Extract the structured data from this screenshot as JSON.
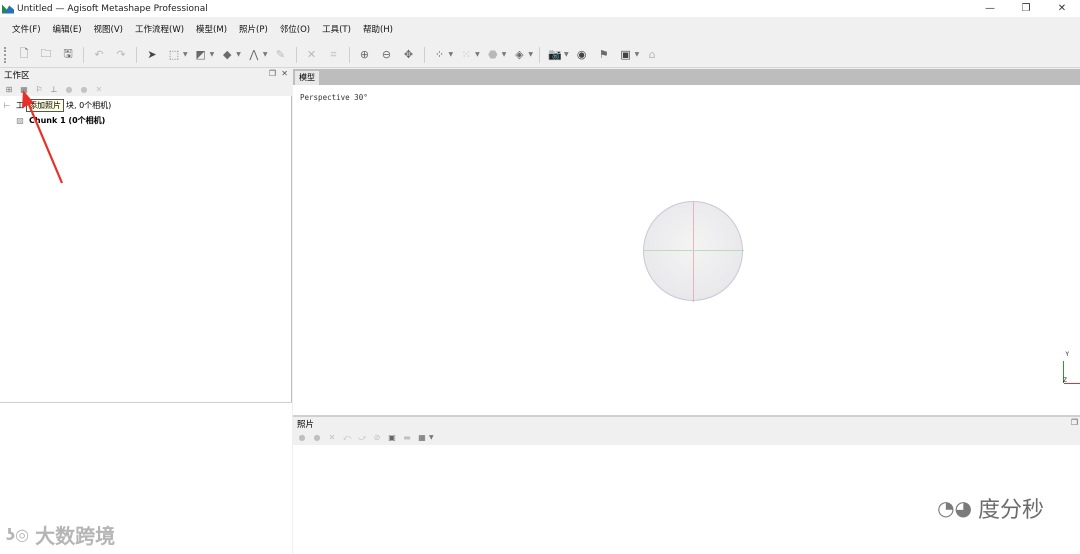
{
  "window": {
    "title": "Untitled — Agisoft Metashape Professional",
    "controls": [
      "—",
      "❐",
      "✕"
    ]
  },
  "menu": [
    "文件(F)",
    "编辑(E)",
    "视图(V)",
    "工作流程(W)",
    "模型(M)",
    "照片(P)",
    "邻位(O)",
    "工具(T)",
    "帮助(H)"
  ],
  "workspace": {
    "title": "工作区",
    "tree_root_prefix": "工",
    "tree_root_suffix": "块, 0个相机)",
    "chunk_label": "Chunk 1 (0个相机)",
    "tooltip": "添加照片"
  },
  "model": {
    "tab": "模型",
    "view_label": "Perspective 30°",
    "axis_y": "Y",
    "axis_z": "Z"
  },
  "photos": {
    "title": "照片"
  },
  "watermarks": {
    "left": "大数跨境",
    "right": "度分秒"
  },
  "colors": {
    "arrow": "#e8302a",
    "trackball_v": "#e8b4b4",
    "trackball_h": "#b9ddb9"
  }
}
